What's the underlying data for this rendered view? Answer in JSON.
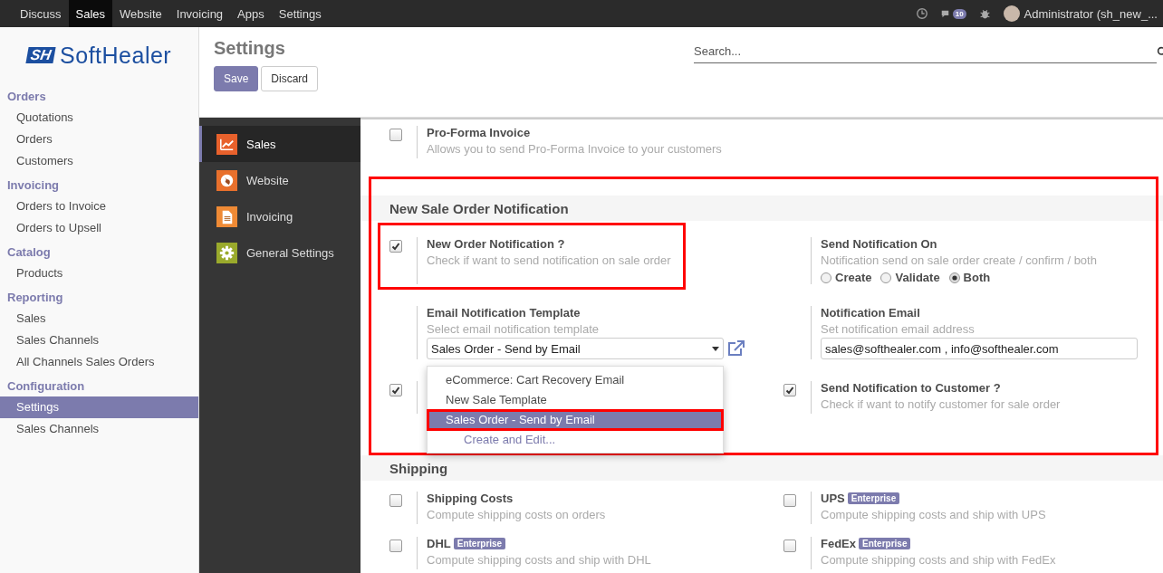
{
  "top_menu": [
    {
      "label": "Discuss",
      "selected": false
    },
    {
      "label": "Sales",
      "selected": true
    },
    {
      "label": "Website",
      "selected": false
    },
    {
      "label": "Invoicing",
      "selected": false
    },
    {
      "label": "Apps",
      "selected": false
    },
    {
      "label": "Settings",
      "selected": false
    }
  ],
  "systray": {
    "message_count": "10",
    "user": "Administrator (sh_new_..."
  },
  "logo": {
    "mark": "SH",
    "name": "SoftHealer"
  },
  "sidebar": [
    {
      "title": "Orders",
      "items": [
        {
          "label": "Quotations",
          "selected": false
        },
        {
          "label": "Orders",
          "selected": false
        },
        {
          "label": "Customers",
          "selected": false
        }
      ]
    },
    {
      "title": "Invoicing",
      "items": [
        {
          "label": "Orders to Invoice",
          "selected": false
        },
        {
          "label": "Orders to Upsell",
          "selected": false
        }
      ]
    },
    {
      "title": "Catalog",
      "items": [
        {
          "label": "Products",
          "selected": false
        }
      ]
    },
    {
      "title": "Reporting",
      "items": [
        {
          "label": "Sales",
          "selected": false
        },
        {
          "label": "Sales Channels",
          "selected": false
        },
        {
          "label": "All Channels Sales Orders",
          "selected": false
        }
      ]
    },
    {
      "title": "Configuration",
      "items": [
        {
          "label": "Settings",
          "selected": true
        },
        {
          "label": "Sales Channels",
          "selected": false
        }
      ]
    }
  ],
  "control_panel": {
    "title": "Settings",
    "search": {
      "placeholder": "Search..."
    },
    "buttons": [
      {
        "label": "Save",
        "kind": "primary"
      },
      {
        "label": "Discard",
        "kind": "secondary"
      }
    ]
  },
  "apps": [
    {
      "label": "Sales",
      "selected": true,
      "kind": "chart",
      "color": "#e8612c"
    },
    {
      "label": "Website",
      "selected": false,
      "kind": "globe",
      "color": "#e8702c"
    },
    {
      "label": "Invoicing",
      "selected": false,
      "kind": "document",
      "color": "#ef8a35"
    },
    {
      "label": "General Settings",
      "selected": false,
      "kind": "gear",
      "color": "#9aaa2c"
    }
  ],
  "sections": [
    {
      "settings": [
        {
          "checked": false,
          "label": "Pro-Forma Invoice",
          "help": "Allows you to send Pro-Forma Invoice to your customers"
        }
      ]
    },
    {
      "title": "New Sale Order Notification",
      "settings": [
        {
          "checked": true,
          "label": "New Order Notification ?",
          "help": "Check if want to send notification on sale order"
        },
        {
          "label": "Send Notification On",
          "help": "Notification send on sale order create / confirm / both",
          "control": {
            "kind": "radio",
            "options": [
              {
                "label": "Create",
                "selected": false
              },
              {
                "label": "Validate",
                "selected": false
              },
              {
                "label": "Both",
                "selected": true
              }
            ]
          }
        },
        {
          "label": "Email Notification Template",
          "help": "Select email notification template",
          "control": {
            "kind": "select",
            "value": "Sales Order - Send by Email",
            "dropdown": {
              "options": [
                {
                  "label": "eCommerce: Cart Recovery Email",
                  "selected": false
                },
                {
                  "label": "New Sale Template",
                  "selected": false
                },
                {
                  "label": "Sales Order - Send by Email",
                  "selected": true
                }
              ],
              "create_link": "Create and Edit..."
            }
          }
        },
        {
          "label": "Notification Email",
          "help": "Set notification email address",
          "control": {
            "kind": "input",
            "value": "sales@softhealer.com , info@softhealer.com"
          }
        },
        {
          "checked": true
        },
        {
          "checked": true,
          "label": "Send Notification to Customer ?",
          "help": "Check if want to notify customer for sale order"
        }
      ]
    },
    {
      "title": "Shipping",
      "settings": [
        {
          "checked": false,
          "label": "Shipping Costs",
          "help": "Compute shipping costs on orders"
        },
        {
          "checked": false,
          "label": "UPS",
          "badge": "Enterprise",
          "help": "Compute shipping costs and ship with UPS"
        },
        {
          "checked": false,
          "label": "DHL",
          "badge": "Enterprise",
          "help": "Compute shipping costs and ship with DHL"
        },
        {
          "checked": false,
          "label": "FedEx",
          "badge": "Enterprise",
          "help": "Compute shipping costs and ship with FedEx"
        }
      ]
    }
  ]
}
